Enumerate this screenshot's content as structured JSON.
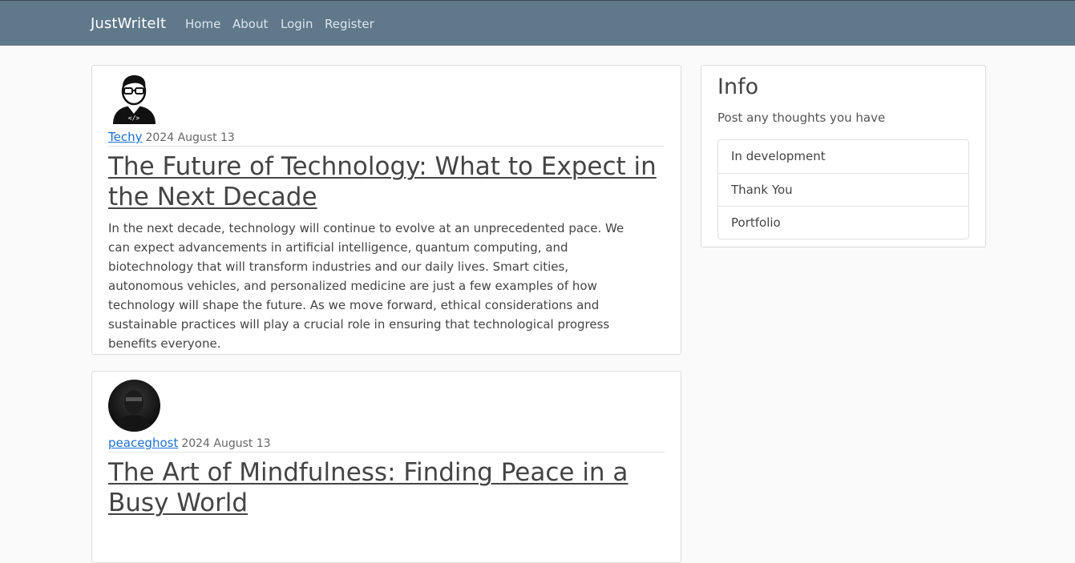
{
  "nav": {
    "brand": "JustWriteIt",
    "links": [
      "Home",
      "About",
      "Login",
      "Register"
    ]
  },
  "posts": [
    {
      "author": "Techy",
      "date": "2024 August 13",
      "avatar_icon": "developer-avatar-icon",
      "title": "The Future of Technology: What to Expect in the Next Decade",
      "body": "In the next decade, technology will continue to evolve at an unprecedented pace. We can expect advancements in artificial intelligence, quantum computing, and biotechnology that will transform industries and our daily lives. Smart cities, autonomous vehicles, and personalized medicine are just a few examples of how technology will shape the future. As we move forward, ethical considerations and sustainable practices will play a crucial role in ensuring that technological progress benefits everyone."
    },
    {
      "author": "peaceghost",
      "date": "2024 August 13",
      "avatar_icon": "masked-figure-avatar",
      "title": "The Art of Mindfulness: Finding Peace in a Busy World",
      "body": ""
    }
  ],
  "sidebar": {
    "title": "Info",
    "subtitle": "Post any thoughts you have",
    "items": [
      "In development",
      "Thank You",
      "Portfolio"
    ]
  },
  "colors": {
    "navbar": "#5f788a",
    "link": "#1a6fd6",
    "background": "#fafafa"
  }
}
